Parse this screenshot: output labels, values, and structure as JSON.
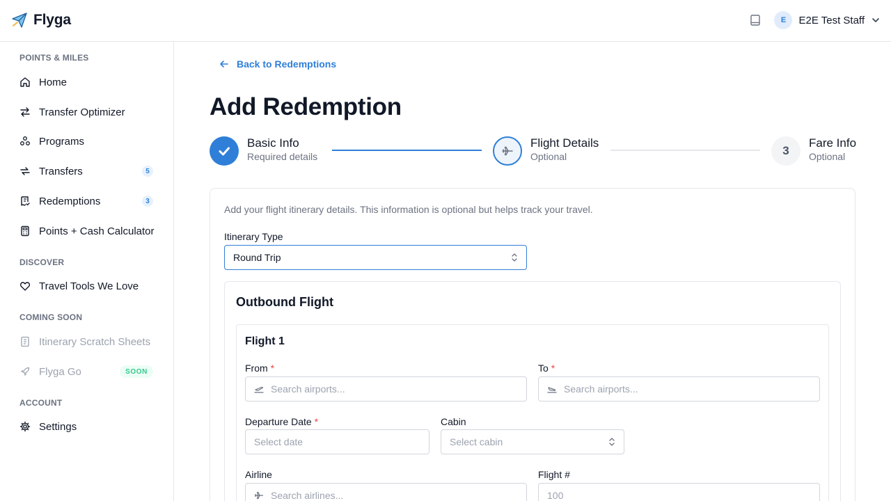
{
  "app": {
    "name": "Flyga"
  },
  "user": {
    "initial": "E",
    "name": "E2E Test Staff"
  },
  "sidebar": {
    "sections": [
      {
        "title": "POINTS & MILES"
      },
      {
        "title": "DISCOVER"
      },
      {
        "title": "COMING SOON"
      },
      {
        "title": "ACCOUNT"
      }
    ],
    "items": [
      {
        "label": "Home",
        "icon": "home-icon"
      },
      {
        "label": "Transfer Optimizer",
        "icon": "arrows-swap-icon"
      },
      {
        "label": "Programs",
        "icon": "programs-icon"
      },
      {
        "label": "Transfers",
        "icon": "transfer-arrows-icon",
        "badge": "5"
      },
      {
        "label": "Redemptions",
        "icon": "receipt-icon",
        "badge": "3"
      },
      {
        "label": "Points + Cash Calculator",
        "icon": "calculator-icon"
      },
      {
        "label": "Travel Tools We Love",
        "icon": "heart-icon"
      },
      {
        "label": "Itinerary Scratch Sheets",
        "icon": "notebook-icon"
      },
      {
        "label": "Flyga Go",
        "icon": "rocket-icon",
        "badge": "SOON"
      },
      {
        "label": "Settings",
        "icon": "gear-icon"
      }
    ]
  },
  "main": {
    "back_label": "Back to Redemptions",
    "title": "Add Redemption",
    "steps": [
      {
        "title": "Basic Info",
        "subtitle": "Required details",
        "status": "complete"
      },
      {
        "title": "Flight Details",
        "subtitle": "Optional",
        "status": "current"
      },
      {
        "title": "Fare Info",
        "subtitle": "Optional",
        "status": "upcoming",
        "number": "3"
      }
    ],
    "intro": "Add your flight itinerary details. This information is optional but helps track your travel.",
    "itinerary_type": {
      "label": "Itinerary Type",
      "value": "Round Trip"
    },
    "outbound": {
      "title": "Outbound Flight",
      "flight_title": "Flight 1",
      "from": {
        "label": "From",
        "required_mark": "*",
        "placeholder": "Search airports..."
      },
      "to": {
        "label": "To",
        "required_mark": "*",
        "placeholder": "Search airports..."
      },
      "departure_date": {
        "label": "Departure Date",
        "required_mark": "*",
        "placeholder": "Select date"
      },
      "cabin": {
        "label": "Cabin",
        "placeholder": "Select cabin"
      },
      "airline": {
        "label": "Airline",
        "placeholder": "Search airlines..."
      },
      "flight_number": {
        "label": "Flight #",
        "placeholder": "100"
      }
    }
  },
  "colors": {
    "accent": "#2f7fd8",
    "required": "#ef4444",
    "muted_text": "#6b7280",
    "border": "#e5e7eb"
  }
}
